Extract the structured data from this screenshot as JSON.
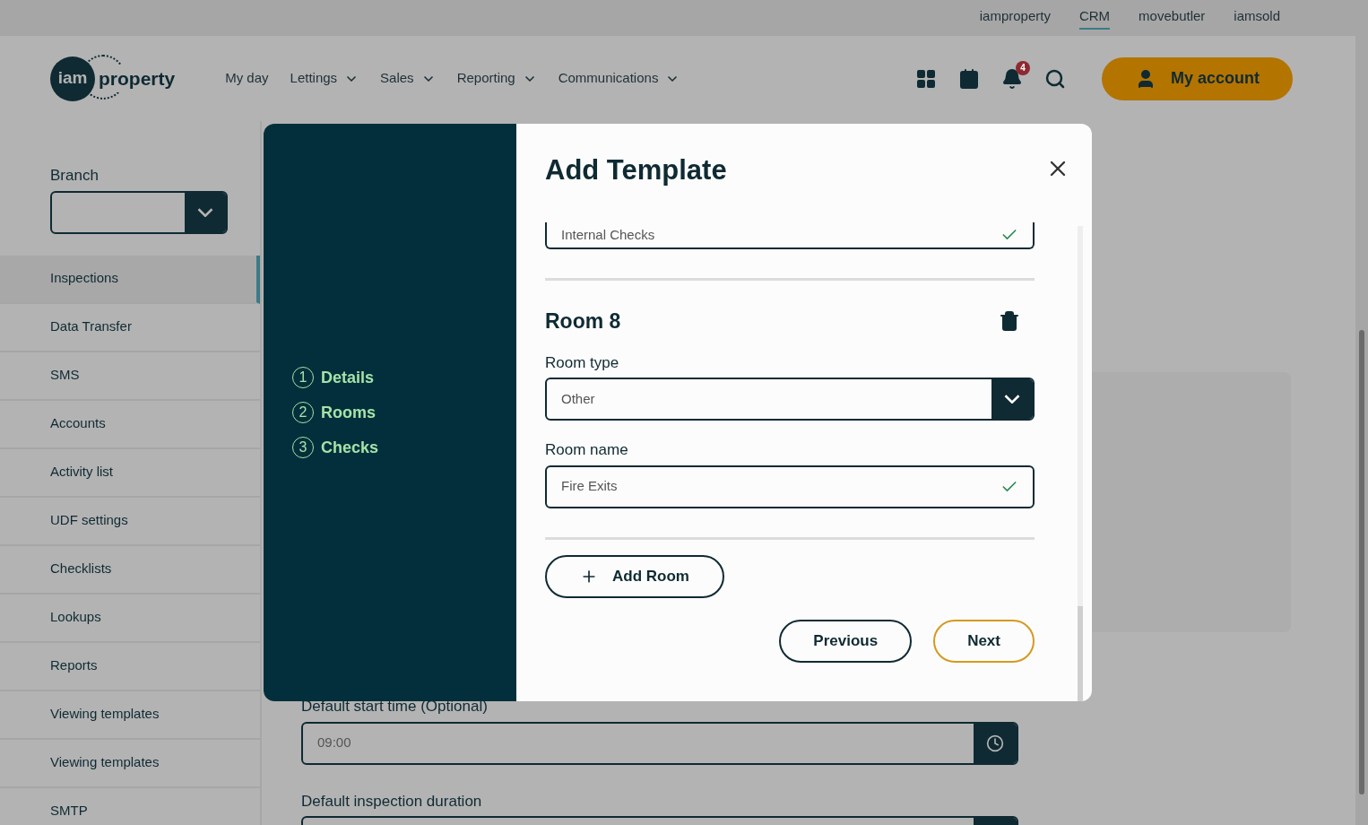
{
  "top_links": [
    {
      "label": "iamproperty",
      "selected": false
    },
    {
      "label": "CRM",
      "selected": true
    },
    {
      "label": "movebutler",
      "selected": false
    },
    {
      "label": "iamsold",
      "selected": false
    }
  ],
  "logo": {
    "mark": "iam",
    "text": "property"
  },
  "nav": [
    {
      "label": "My day",
      "dropdown": false
    },
    {
      "label": "Lettings",
      "dropdown": true
    },
    {
      "label": "Sales",
      "dropdown": true
    },
    {
      "label": "Reporting",
      "dropdown": true
    },
    {
      "label": "Communications",
      "dropdown": true
    }
  ],
  "notifications_count": "4",
  "account_button": "My account",
  "sidebar": {
    "branch_label": "Branch",
    "items": [
      {
        "label": "Inspections",
        "selected": true
      },
      {
        "label": "Data Transfer",
        "selected": false
      },
      {
        "label": "SMS",
        "selected": false
      },
      {
        "label": "Accounts",
        "selected": false
      },
      {
        "label": "Activity list",
        "selected": false
      },
      {
        "label": "UDF settings",
        "selected": false
      },
      {
        "label": "Checklists",
        "selected": false
      },
      {
        "label": "Lookups",
        "selected": false
      },
      {
        "label": "Reports",
        "selected": false
      },
      {
        "label": "Viewing templates",
        "selected": false
      },
      {
        "label": "Viewing templates",
        "selected": false
      },
      {
        "label": "SMTP",
        "selected": false
      }
    ]
  },
  "form": {
    "start_time_label": "Default start time (Optional)",
    "start_time_value": "09:00",
    "duration_label": "Default inspection duration"
  },
  "modal": {
    "title": "Add Template",
    "steps": [
      {
        "number": "1",
        "label": "Details"
      },
      {
        "number": "2",
        "label": "Rooms"
      },
      {
        "number": "3",
        "label": "Checks"
      }
    ],
    "previous_field": {
      "value": "Internal Checks",
      "valid": true
    },
    "room": {
      "title": "Room 8",
      "type_label": "Room type",
      "type_value": "Other",
      "name_label": "Room name",
      "name_value": "Fire Exits",
      "name_valid": true
    },
    "add_room": "Add Room",
    "buttons": [
      {
        "label": "Previous",
        "kind": "secondary"
      },
      {
        "label": "Next",
        "kind": "primary"
      }
    ]
  }
}
